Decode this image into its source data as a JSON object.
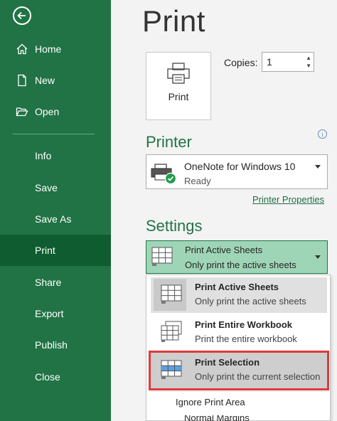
{
  "sidebar": {
    "items": [
      {
        "label": "Home",
        "icon": "home-icon"
      },
      {
        "label": "New",
        "icon": "new-file-icon"
      },
      {
        "label": "Open",
        "icon": "folder-open-icon"
      },
      {
        "label": "Info"
      },
      {
        "label": "Save"
      },
      {
        "label": "Save As"
      },
      {
        "label": "Print",
        "active": true
      },
      {
        "label": "Share"
      },
      {
        "label": "Export"
      },
      {
        "label": "Publish"
      },
      {
        "label": "Close"
      }
    ]
  },
  "page": {
    "title": "Print",
    "print_button": "Print",
    "copies_label": "Copies:",
    "copies_value": "1"
  },
  "printer": {
    "heading": "Printer",
    "name": "OneNote for Windows 10",
    "status": "Ready",
    "properties_link": "Printer Properties"
  },
  "settings": {
    "heading": "Settings",
    "current_title": "Print Active Sheets",
    "current_desc": "Only print the active sheets",
    "options": [
      {
        "title": "Print Active Sheets",
        "desc": "Only print the active sheets"
      },
      {
        "title": "Print Entire Workbook",
        "desc": "Print the entire workbook"
      },
      {
        "title": "Print Selection",
        "desc": "Only print the current selection"
      }
    ],
    "ignore_print_area": "Ignore Print Area",
    "next_setting": "Normal Margins"
  },
  "colors": {
    "brand": "#217346",
    "active_nav": "#0e5c2f",
    "dropdown_selected": "#9fd5b7",
    "highlight_border": "#e03a3a"
  }
}
